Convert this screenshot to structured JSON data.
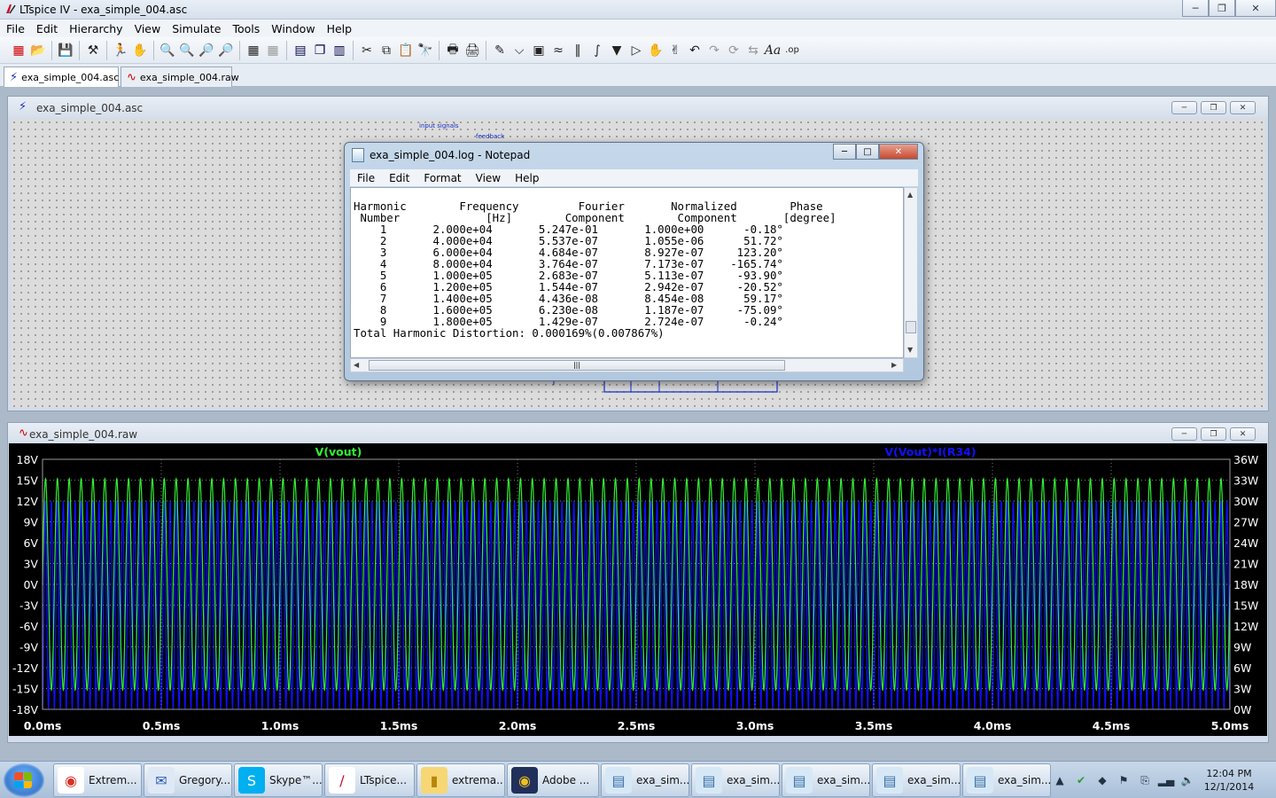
{
  "app_title": "LTspice IV - exa_simple_004.asc",
  "menu": [
    "File",
    "Edit",
    "Hierarchy",
    "View",
    "Simulate",
    "Tools",
    "Window",
    "Help"
  ],
  "tabs": [
    {
      "label": "exa_simple_004.asc",
      "icon": "schematic-icon",
      "active": true
    },
    {
      "label": "exa_simple_004.raw",
      "icon": "waveform-icon",
      "active": false
    }
  ],
  "schematic_window": {
    "title": "exa_simple_004.asc",
    "labels": [
      "input signals",
      "feedback"
    ]
  },
  "waveform_window": {
    "title": "exa_simple_004.raw"
  },
  "notepad": {
    "title": "exa_simple_004.log - Notepad",
    "menu": [
      "File",
      "Edit",
      "Format",
      "View",
      "Help"
    ],
    "table": {
      "headers_line1": [
        "Harmonic",
        "Frequency",
        "Fourier",
        "Normalized",
        "Phase"
      ],
      "headers_line2": [
        "Number",
        "[Hz]",
        "Component",
        "Component",
        "[degree]"
      ],
      "rows": [
        [
          "1",
          "2.000e+04",
          "5.247e-01",
          "1.000e+00",
          "-0.18°"
        ],
        [
          "2",
          "4.000e+04",
          "5.537e-07",
          "1.055e-06",
          "51.72°"
        ],
        [
          "3",
          "6.000e+04",
          "4.684e-07",
          "8.927e-07",
          "123.20°"
        ],
        [
          "4",
          "8.000e+04",
          "3.764e-07",
          "7.173e-07",
          "-165.74°"
        ],
        [
          "5",
          "1.000e+05",
          "2.683e-07",
          "5.113e-07",
          "-93.90°"
        ],
        [
          "6",
          "1.200e+05",
          "1.544e-07",
          "2.942e-07",
          "-20.52°"
        ],
        [
          "7",
          "1.400e+05",
          "4.436e-08",
          "8.454e-08",
          "59.17°"
        ],
        [
          "8",
          "1.600e+05",
          "6.230e-08",
          "1.187e-07",
          "-75.09°"
        ],
        [
          "9",
          "1.800e+05",
          "1.429e-07",
          "2.724e-07",
          "-0.24°"
        ]
      ],
      "thd_line": "Total Harmonic Distortion: 0.000169%(0.007867%)"
    }
  },
  "chart_data": {
    "type": "line",
    "series": [
      {
        "name": "V(vout)",
        "color": "#33ee33",
        "axis": "left",
        "min": -15.2,
        "max": 15.2,
        "frequency_hz": 20000
      },
      {
        "name": "V(Vout)*I(R34)",
        "color": "#1010ff",
        "axis": "right",
        "min": 0,
        "max": 30,
        "frequency_hz": 40000
      }
    ],
    "x_ticks": [
      "0.0ms",
      "0.5ms",
      "1.0ms",
      "1.5ms",
      "2.0ms",
      "2.5ms",
      "3.0ms",
      "3.5ms",
      "4.0ms",
      "4.5ms",
      "5.0ms"
    ],
    "xlim": [
      0,
      5.0
    ],
    "x_unit": "ms",
    "y_left_ticks": [
      "18V",
      "15V",
      "12V",
      "9V",
      "6V",
      "3V",
      "0V",
      "-3V",
      "-6V",
      "-9V",
      "-12V",
      "-15V",
      "-18V"
    ],
    "ylim_left": [
      -18,
      18
    ],
    "y_right_ticks": [
      "36W",
      "33W",
      "30W",
      "27W",
      "24W",
      "21W",
      "18W",
      "15W",
      "12W",
      "9W",
      "6W",
      "3W",
      "0W"
    ],
    "ylim_right": [
      0,
      36
    ],
    "grid": true
  },
  "taskbar": {
    "items": [
      {
        "label": "Extrem...",
        "icon": "chrome-icon"
      },
      {
        "label": "Gregory...",
        "icon": "thunderbird-icon"
      },
      {
        "label": "Skype™...",
        "icon": "skype-icon"
      },
      {
        "label": "LTspice...",
        "icon": "ltspice-icon"
      },
      {
        "label": "extrema...",
        "icon": "folder-icon"
      },
      {
        "label": "Adobe ...",
        "icon": "adobe-icon"
      },
      {
        "label": "exa_sim...",
        "icon": "notepad-icon"
      },
      {
        "label": "exa_sim...",
        "icon": "notepad-icon"
      },
      {
        "label": "exa_sim...",
        "icon": "notepad-icon"
      },
      {
        "label": "exa_sim...",
        "icon": "notepad-icon"
      },
      {
        "label": "exa_sim...",
        "icon": "notepad-icon"
      }
    ],
    "clock_time": "12:04 PM",
    "clock_date": "12/1/2014"
  }
}
